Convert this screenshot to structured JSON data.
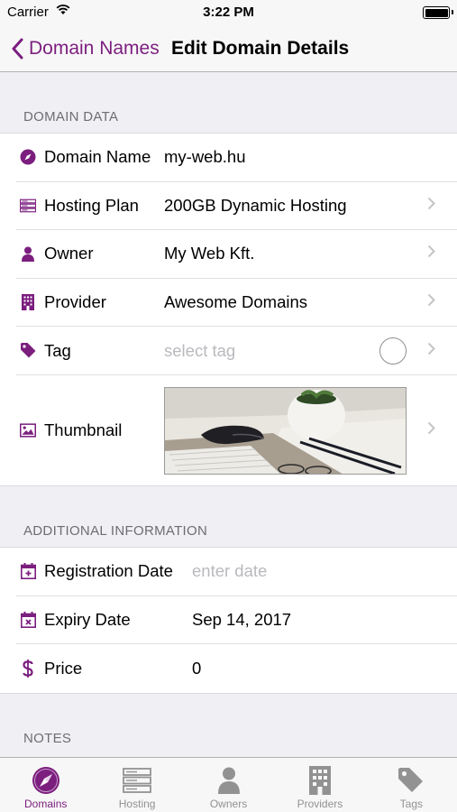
{
  "status_bar": {
    "carrier": "Carrier",
    "time": "3:22 PM"
  },
  "nav": {
    "back_label": "Domain Names",
    "title": "Edit Domain Details"
  },
  "domain_data": {
    "header": "DOMAIN DATA",
    "domain_name": {
      "label": "Domain Name",
      "value": "my-web.hu"
    },
    "hosting_plan": {
      "label": "Hosting Plan",
      "value": "200GB Dynamic Hosting"
    },
    "owner": {
      "label": "Owner",
      "value": "My Web Kft."
    },
    "provider": {
      "label": "Provider",
      "value": "Awesome Domains"
    },
    "tag": {
      "label": "Tag",
      "placeholder": "select tag"
    },
    "thumbnail": {
      "label": "Thumbnail"
    }
  },
  "additional": {
    "header": "ADDITIONAL INFORMATION",
    "registration_date": {
      "label": "Registration Date",
      "placeholder": "enter date"
    },
    "expiry_date": {
      "label": "Expiry Date",
      "value": "Sep 14, 2017"
    },
    "price": {
      "label": "Price",
      "value": "0"
    }
  },
  "notes": {
    "header": "NOTES"
  },
  "tabs": [
    {
      "label": "Domains",
      "icon": "compass-icon",
      "active": true
    },
    {
      "label": "Hosting",
      "icon": "server-icon",
      "active": false
    },
    {
      "label": "Owners",
      "icon": "person-icon",
      "active": false
    },
    {
      "label": "Providers",
      "icon": "building-icon",
      "active": false
    },
    {
      "label": "Tags",
      "icon": "tag-icon",
      "active": false
    }
  ],
  "colors": {
    "accent": "#7b1e7e",
    "inactive": "#929292",
    "background": "#efeff4"
  }
}
